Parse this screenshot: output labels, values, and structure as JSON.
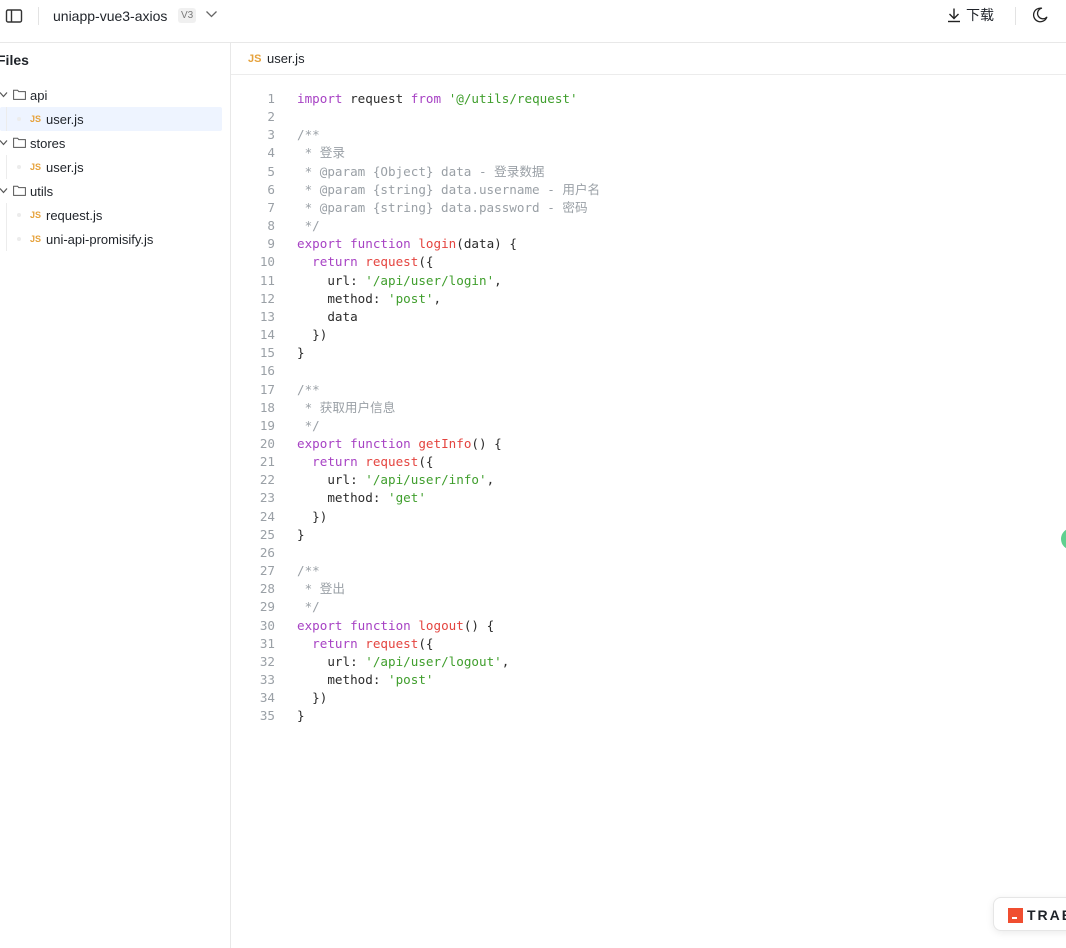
{
  "header": {
    "project_name": "uniapp-vue3-axios",
    "version": "V3",
    "download_label": "下载"
  },
  "sidebar": {
    "title": "Files",
    "tree": [
      {
        "type": "folder",
        "label": "api"
      },
      {
        "type": "file",
        "label": "user.js",
        "tag": "JS",
        "active": true
      },
      {
        "type": "folder",
        "label": "stores"
      },
      {
        "type": "file",
        "label": "user.js",
        "tag": "JS"
      },
      {
        "type": "folder",
        "label": "utils"
      },
      {
        "type": "file",
        "label": "request.js",
        "tag": "JS"
      },
      {
        "type": "file",
        "label": "uni-api-promisify.js",
        "tag": "JS"
      }
    ]
  },
  "editor": {
    "tab_tag": "JS",
    "tab_label": "user.js",
    "lines": [
      [
        [
          "kw",
          "import"
        ],
        [
          "t",
          " request "
        ],
        [
          "kw",
          "from"
        ],
        [
          "t",
          " "
        ],
        [
          "str",
          "'@/utils/request'"
        ]
      ],
      [],
      [
        [
          "cm",
          "/**"
        ]
      ],
      [
        [
          "cm",
          " * 登录"
        ]
      ],
      [
        [
          "cm",
          " * @param {Object} data - 登录数据"
        ]
      ],
      [
        [
          "cm",
          " * @param {string} data.username - 用户名"
        ]
      ],
      [
        [
          "cm",
          " * @param {string} data.password - 密码"
        ]
      ],
      [
        [
          "cm",
          " */"
        ]
      ],
      [
        [
          "kw",
          "export function"
        ],
        [
          "t",
          " "
        ],
        [
          "fn",
          "login"
        ],
        [
          "t",
          "(data) {"
        ]
      ],
      [
        [
          "t",
          "  "
        ],
        [
          "kw",
          "return"
        ],
        [
          "t",
          " "
        ],
        [
          "fn",
          "request"
        ],
        [
          "t",
          "({"
        ]
      ],
      [
        [
          "t",
          "    url: "
        ],
        [
          "str",
          "'/api/user/login'"
        ],
        [
          "t",
          ","
        ]
      ],
      [
        [
          "t",
          "    method: "
        ],
        [
          "str",
          "'post'"
        ],
        [
          "t",
          ","
        ]
      ],
      [
        [
          "t",
          "    data"
        ]
      ],
      [
        [
          "t",
          "  })"
        ]
      ],
      [
        [
          "t",
          "}"
        ]
      ],
      [],
      [
        [
          "cm",
          "/**"
        ]
      ],
      [
        [
          "cm",
          " * 获取用户信息"
        ]
      ],
      [
        [
          "cm",
          " */"
        ]
      ],
      [
        [
          "kw",
          "export function"
        ],
        [
          "t",
          " "
        ],
        [
          "fn",
          "getInfo"
        ],
        [
          "t",
          "() {"
        ]
      ],
      [
        [
          "t",
          "  "
        ],
        [
          "kw",
          "return"
        ],
        [
          "t",
          " "
        ],
        [
          "fn",
          "request"
        ],
        [
          "t",
          "({"
        ]
      ],
      [
        [
          "t",
          "    url: "
        ],
        [
          "str",
          "'/api/user/info'"
        ],
        [
          "t",
          ","
        ]
      ],
      [
        [
          "t",
          "    method: "
        ],
        [
          "str",
          "'get'"
        ]
      ],
      [
        [
          "t",
          "  })"
        ]
      ],
      [
        [
          "t",
          "}"
        ]
      ],
      [],
      [
        [
          "cm",
          "/**"
        ]
      ],
      [
        [
          "cm",
          " * 登出"
        ]
      ],
      [
        [
          "cm",
          " */"
        ]
      ],
      [
        [
          "kw",
          "export function"
        ],
        [
          "t",
          " "
        ],
        [
          "fn",
          "logout"
        ],
        [
          "t",
          "() {"
        ]
      ],
      [
        [
          "t",
          "  "
        ],
        [
          "kw",
          "return"
        ],
        [
          "t",
          " "
        ],
        [
          "fn",
          "request"
        ],
        [
          "t",
          "({"
        ]
      ],
      [
        [
          "t",
          "    url: "
        ],
        [
          "str",
          "'/api/user/logout'"
        ],
        [
          "t",
          ","
        ]
      ],
      [
        [
          "t",
          "    method: "
        ],
        [
          "str",
          "'post'"
        ]
      ],
      [
        [
          "t",
          "  })"
        ]
      ],
      [
        [
          "t",
          "}"
        ]
      ]
    ]
  },
  "badge": {
    "text": "TRAE"
  },
  "colors": {
    "keyword": "#a742c4",
    "function": "#e4443f",
    "string": "#3f9e2c",
    "comment": "#9aa0a6",
    "js_tag": "#e6a23c",
    "active_row": "#eef4ff"
  },
  "icons": {
    "sidebar_toggle": "sidebar-toggle-icon",
    "chevron": "chevron-down-icon",
    "download": "download-icon",
    "theme": "moon-icon",
    "folder": "folder-icon"
  }
}
